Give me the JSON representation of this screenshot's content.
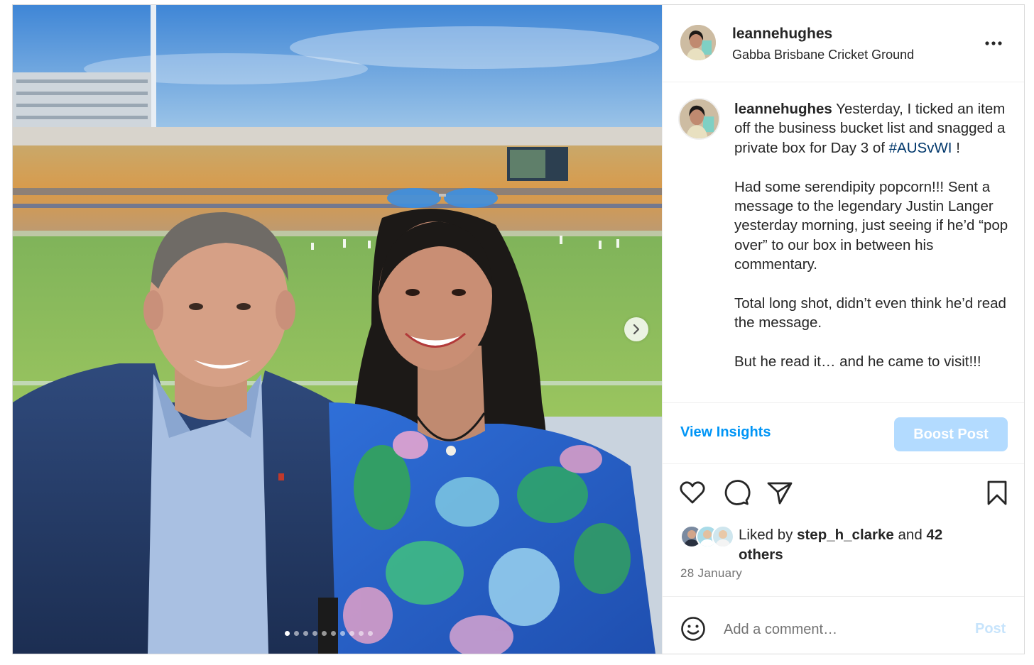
{
  "post": {
    "username": "leannehughes",
    "location": "Gabba Brisbane Cricket Ground",
    "caption": {
      "username": "leannehughes",
      "text_1": " Yesterday, I ticked an item off the business bucket list and snagged a private box for Day 3 of ",
      "hashtag": "#AUSvWI",
      "text_2": " !",
      "paragraph_2": "Had some serendipity popcorn!!! Sent a message to the legendary Justin Langer yesterday morning, just seeing if he’d “pop over” to our box in between his commentary.",
      "paragraph_3": "Total long shot, didn’t even think he’d read the message.",
      "paragraph_4": "But he read it… and he came to visit!!!"
    },
    "view_insights_label": "View Insights",
    "boost_post_label": "Boost Post",
    "likes": {
      "prefix": "Liked by ",
      "liker": "step_h_clarke",
      "middle": " and ",
      "count_text": "42 others"
    },
    "date": "28 January",
    "comment_placeholder": "Add a comment…",
    "post_button_label": "Post",
    "carousel": {
      "current": 1,
      "total": 10
    },
    "icons": [
      "more-icon",
      "heart-icon",
      "comment-icon",
      "share-icon",
      "bookmark-icon",
      "emoji-icon",
      "chevron-right-icon"
    ],
    "colors": {
      "link_blue": "#0095f6",
      "boost_bg": "#b3dbff",
      "hashtag": "#00376b"
    }
  }
}
